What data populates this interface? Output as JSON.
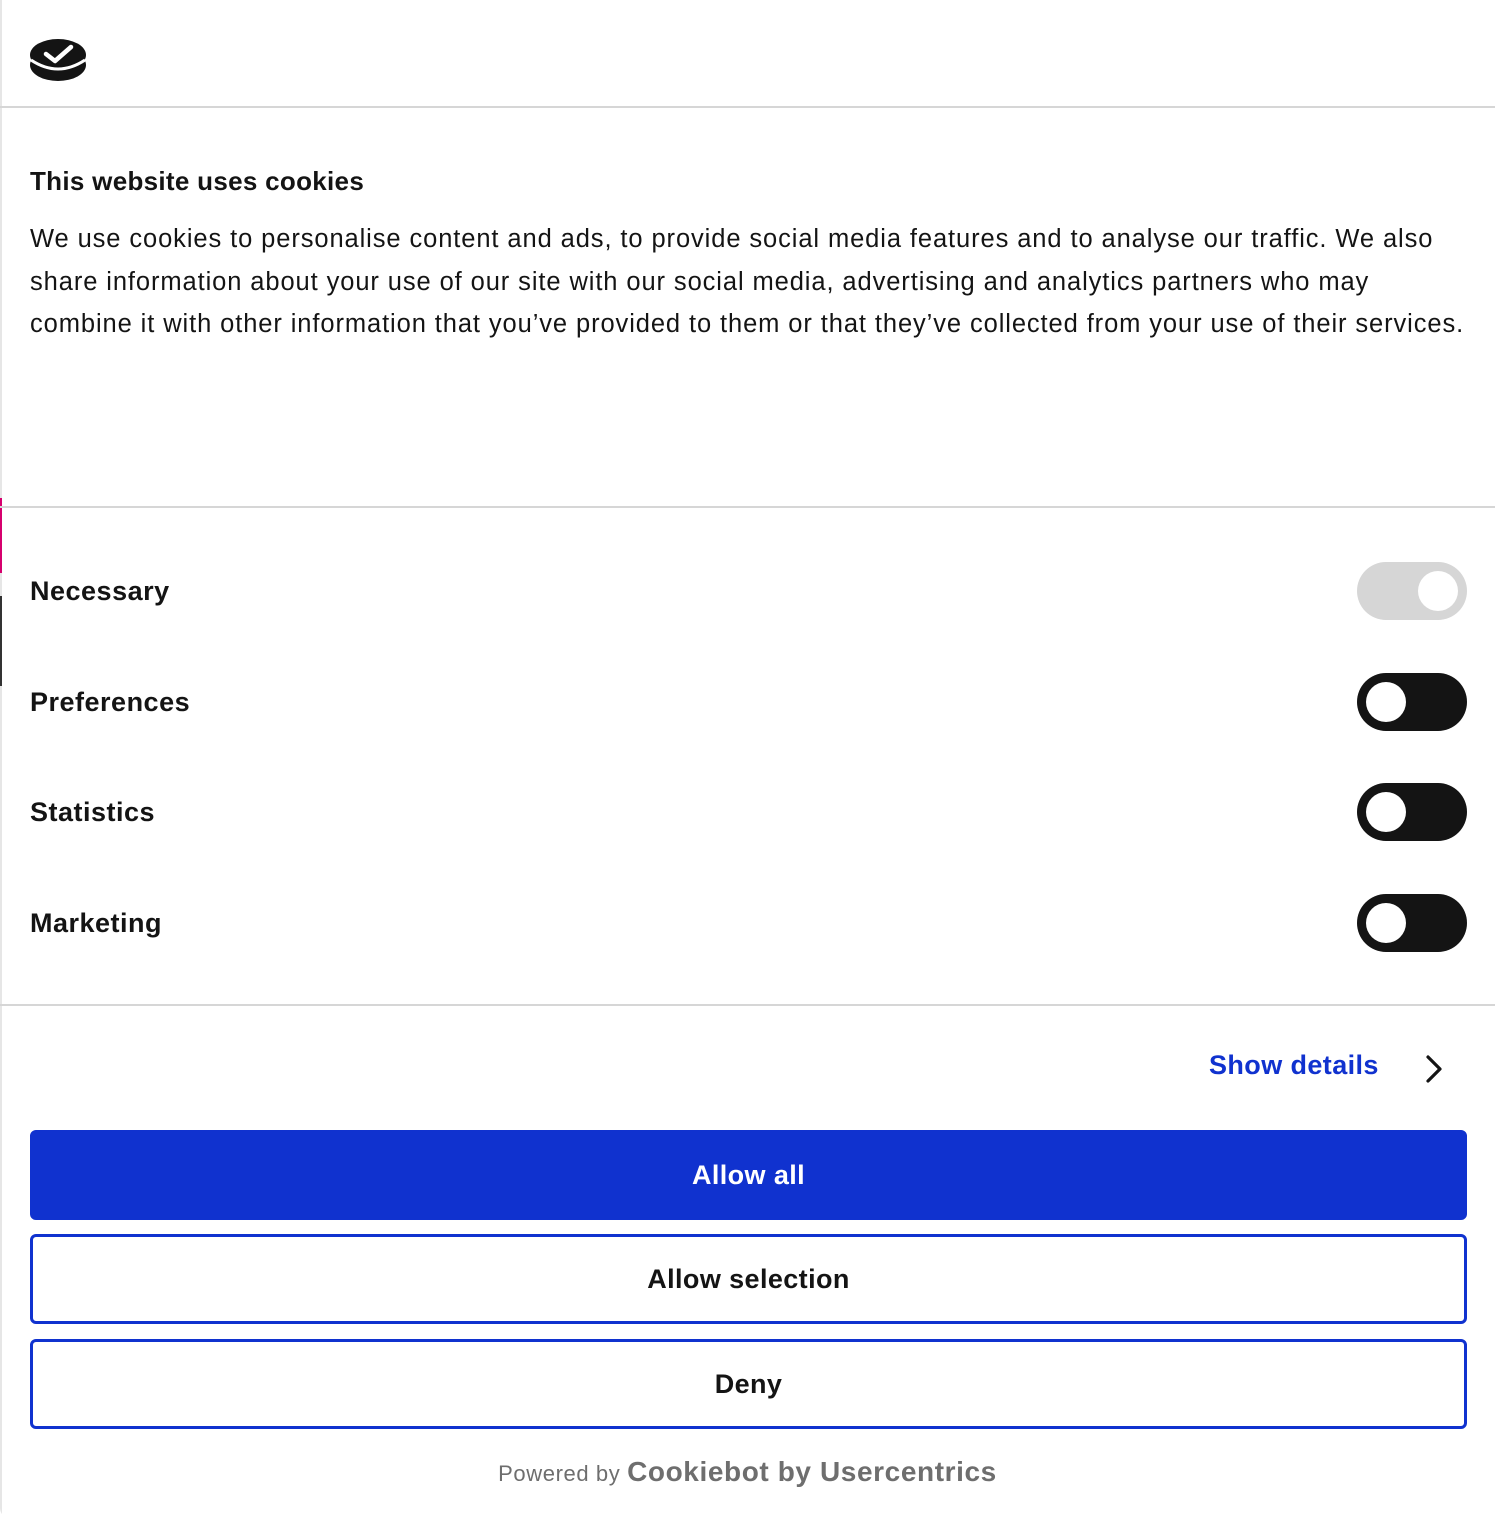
{
  "header": {
    "logo_icon": "cookiebot-logo-icon"
  },
  "content": {
    "title": "This website uses cookies",
    "description": "We use cookies to personalise content and ads, to provide social media features and to analyse our traffic. We also share information about your use of our site with our social media, advertising and analytics partners who may combine it with other information that you’ve provided to them or that they’ve collected from your use of their services."
  },
  "toggles": [
    {
      "label": "Necessary",
      "checked": true,
      "disabled": true
    },
    {
      "label": "Preferences",
      "checked": false,
      "disabled": false
    },
    {
      "label": "Statistics",
      "checked": false,
      "disabled": false
    },
    {
      "label": "Marketing",
      "checked": false,
      "disabled": false
    }
  ],
  "footer": {
    "show_details": "Show details",
    "allow_all": "Allow all",
    "allow_selection": "Allow selection",
    "deny": "Deny",
    "powered_by": "Powered by",
    "brand": "Cookiebot by Usercentrics"
  },
  "colors": {
    "accent": "#1032cf",
    "text": "#141414",
    "toggle_off_track": "#141414",
    "toggle_disabled_track": "#d6d6d6",
    "divider": "#d6d6d6",
    "muted_text": "#6e6e6e"
  }
}
